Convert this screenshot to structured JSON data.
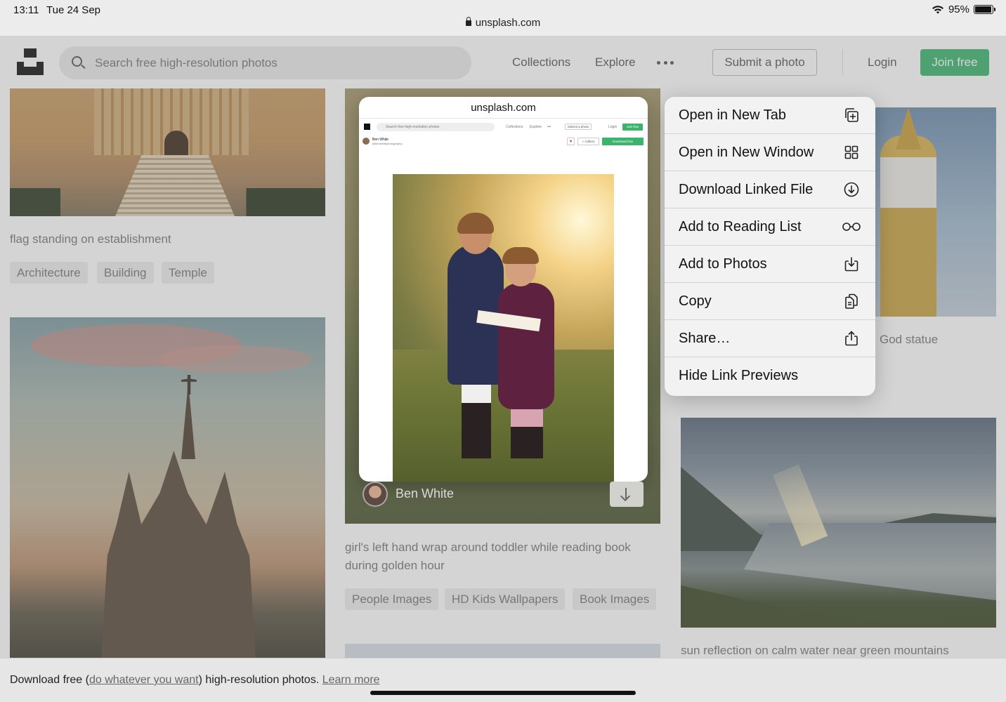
{
  "status_bar": {
    "time": "13:11",
    "date": "Tue 24 Sep",
    "battery": "95%",
    "url": "unsplash.com"
  },
  "header": {
    "search_placeholder": "Search free high-resolution photos",
    "nav": [
      "Collections",
      "Explore"
    ],
    "submit_label": "Submit a photo",
    "login_label": "Login",
    "join_label": "Join free",
    "join_color": "#3cb46e"
  },
  "grid": {
    "temple": {
      "caption": "flag standing on establishment",
      "tags": [
        "Architecture",
        "Building",
        "Temple"
      ]
    },
    "kids": {
      "author": "Ben White",
      "caption_line1": "girl's left hand wrap around toddler while reading book",
      "caption_line2": "during golden hour",
      "tags": [
        "People Images",
        "HD Kids Wallpapers",
        "Book Images"
      ]
    },
    "deity": {
      "caption_fragment": "God statue"
    },
    "lake": {
      "caption": "sun reflection on calm water near green mountains"
    }
  },
  "preview": {
    "title": "unsplash.com",
    "mini": {
      "search": "Search free high-resolution photos",
      "collections": "Collections",
      "explore": "Explore",
      "submit": "Submit a photo",
      "login": "Login",
      "join": "Join free",
      "author": "Ben White",
      "handle": "@benwhitephotography",
      "collect": "+ Collect",
      "download": "Download free"
    }
  },
  "context_menu": {
    "items": [
      {
        "label": "Open in New Tab",
        "icon": "new-tab-icon"
      },
      {
        "label": "Open in New Window",
        "icon": "new-window-icon"
      },
      {
        "label": "Download Linked File",
        "icon": "download-icon"
      },
      {
        "label": "Add to Reading List",
        "icon": "glasses-icon"
      },
      {
        "label": "Add to Photos",
        "icon": "save-to-photos-icon"
      },
      {
        "label": "Copy",
        "icon": "copy-icon"
      },
      {
        "label": "Share…",
        "icon": "share-icon"
      },
      {
        "label": "Hide Link Previews",
        "icon": ""
      }
    ]
  },
  "footer": {
    "prefix": "Download free (",
    "link1": "do whatever you want",
    "middle": ") high-resolution photos. ",
    "link2": "Learn more"
  }
}
